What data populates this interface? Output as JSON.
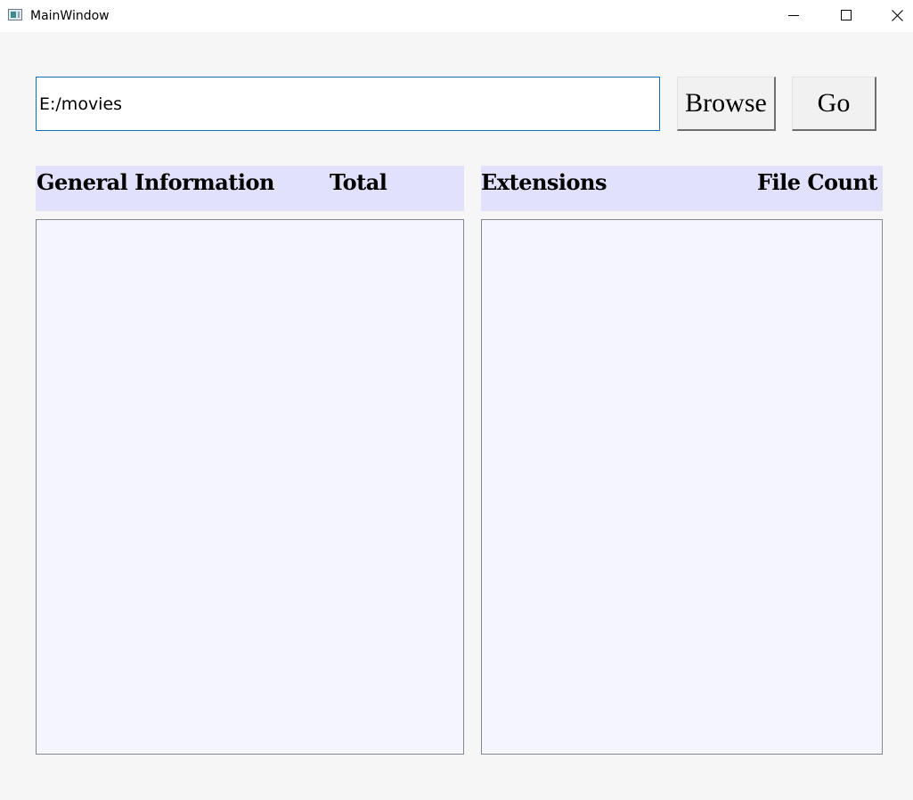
{
  "window": {
    "title": "MainWindow",
    "controls": [
      "minimize-icon",
      "maximize-icon",
      "close-icon"
    ]
  },
  "path_bar": {
    "value": "E:/movies",
    "browse_label": "Browse",
    "go_label": "Go"
  },
  "general_panel": {
    "header_left": "General Information",
    "header_right": "Total",
    "rows": []
  },
  "extensions_panel": {
    "header_left": "Extensions",
    "header_right": "File Count",
    "rows": []
  },
  "colors": {
    "header_background": "#e2e1fc",
    "list_background": "#f5f6fd",
    "input_border": "#0a6fb8",
    "window_background": "#f5f6f5"
  }
}
